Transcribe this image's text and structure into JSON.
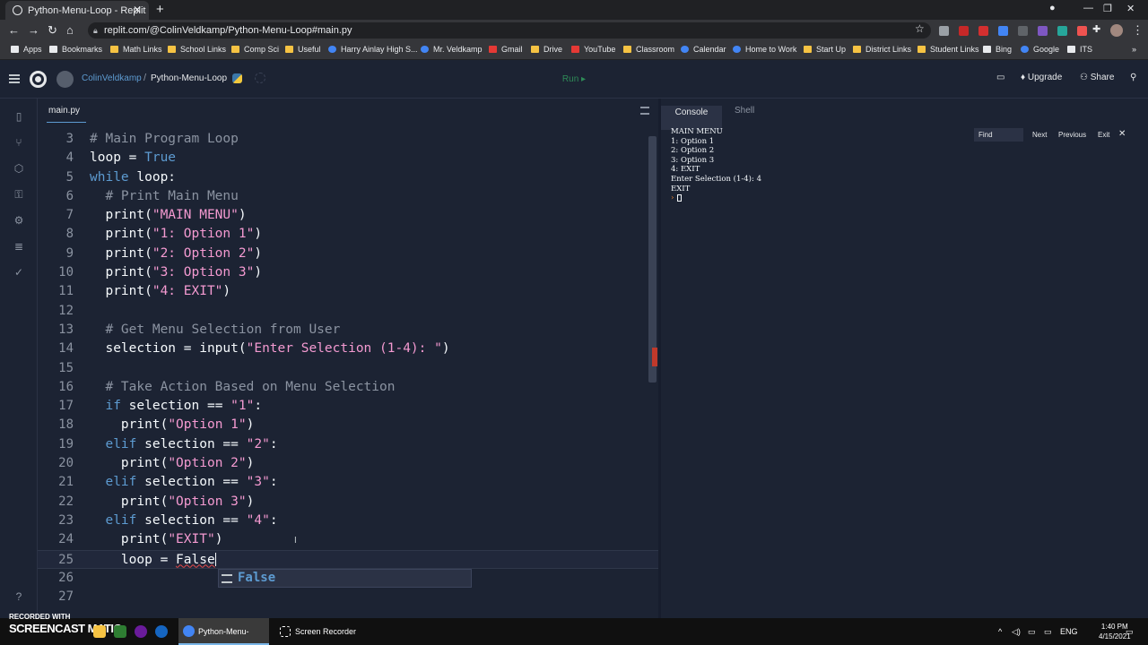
{
  "browser": {
    "tab_title": "Python-Menu-Loop - Replit",
    "url": "replit.com/@ColinVeldkamp/Python-Menu-Loop#main.py",
    "bookmarks": [
      "Apps",
      "Bookmarks",
      "Math Links",
      "School Links",
      "Comp Sci",
      "Useful",
      "Harry Ainlay High S...",
      "Mr. Veldkamp",
      "Gmail",
      "Drive",
      "YouTube",
      "Classroom",
      "Calendar",
      "Home to Work",
      "Start Up",
      "District Links",
      "Student Links",
      "Bing",
      "Google",
      "ITS"
    ]
  },
  "header": {
    "user": "ColinVeldkamp",
    "separator": "/",
    "repl": "Python-Menu-Loop",
    "run_label": "Run ▸",
    "upgrade_label": "Upgrade",
    "share_label": "Share"
  },
  "editor": {
    "file_tab": "main.py",
    "lines": [
      {
        "num": "3",
        "html": "<span class='c'># Main Program Loop</span>"
      },
      {
        "num": "4",
        "html": "loop = <span class='k'>True</span>"
      },
      {
        "num": "5",
        "html": "<span class='k'>while</span> loop:"
      },
      {
        "num": "6",
        "html": "  <span class='c'># Print Main Menu</span>"
      },
      {
        "num": "7",
        "html": "  print(<span class='s'>\"MAIN MENU\"</span>)"
      },
      {
        "num": "8",
        "html": "  print(<span class='s'>\"1: Option 1\"</span>)"
      },
      {
        "num": "9",
        "html": "  print(<span class='s'>\"2: Option 2\"</span>)"
      },
      {
        "num": "10",
        "html": "  print(<span class='s'>\"3: Option 3\"</span>)"
      },
      {
        "num": "11",
        "html": "  print(<span class='s'>\"4: EXIT\"</span>)"
      },
      {
        "num": "12",
        "html": ""
      },
      {
        "num": "13",
        "html": "  <span class='c'># Get Menu Selection from User</span>"
      },
      {
        "num": "14",
        "html": "  selection = input(<span class='s'>\"Enter Selection (1-4): \"</span>)"
      },
      {
        "num": "15",
        "html": ""
      },
      {
        "num": "16",
        "html": "  <span class='c'># Take Action Based on Menu Selection</span>"
      },
      {
        "num": "17",
        "html": "  <span class='k'>if</span> selection == <span class='s'>\"1\"</span>:"
      },
      {
        "num": "18",
        "html": "    print(<span class='s'>\"Option 1\"</span>)"
      },
      {
        "num": "19",
        "html": "  <span class='k'>elif</span> selection == <span class='s'>\"2\"</span>:"
      },
      {
        "num": "20",
        "html": "    print(<span class='s'>\"Option 2\"</span>)"
      },
      {
        "num": "21",
        "html": "  <span class='k'>elif</span> selection == <span class='s'>\"3\"</span>:"
      },
      {
        "num": "22",
        "html": "    print(<span class='s'>\"Option 3\"</span>)"
      },
      {
        "num": "23",
        "html": "  <span class='k'>elif</span> selection == <span class='s'>\"4\"</span>:"
      },
      {
        "num": "24",
        "html": "    print(<span class='s'>\"EXIT\"</span>)"
      },
      {
        "num": "25",
        "html": "    loop = <span class='squiggle'>False</span><span class='cursor'></span>",
        "active": true
      },
      {
        "num": "26",
        "html": ""
      },
      {
        "num": "27",
        "html": ""
      }
    ],
    "autocomplete": "False"
  },
  "console": {
    "tab_console": "Console",
    "tab_shell": "Shell",
    "output": [
      "MAIN MENU",
      "1: Option 1",
      "2: Option 2",
      "3: Option 3",
      "4: EXIT",
      "Enter Selection (1-4): 4",
      "EXIT"
    ],
    "find_label": "Find",
    "next_label": "Next",
    "previous_label": "Previous",
    "exit_label": "Exit"
  },
  "taskbar": {
    "recorded_with": "RECORDED WITH",
    "brand": "SCREENCAST  MATIC",
    "active_app": "Python-Menu-Loo...",
    "recorder": "Screen Recorder",
    "lang": "ENG",
    "time": "1:40 PM",
    "date": "4/15/2021"
  },
  "colors": {
    "accent": "#5d9bd1",
    "string": "#f49ad1",
    "comment": "#8b93a1",
    "run": "#2e8b57",
    "background": "#1c2333"
  }
}
